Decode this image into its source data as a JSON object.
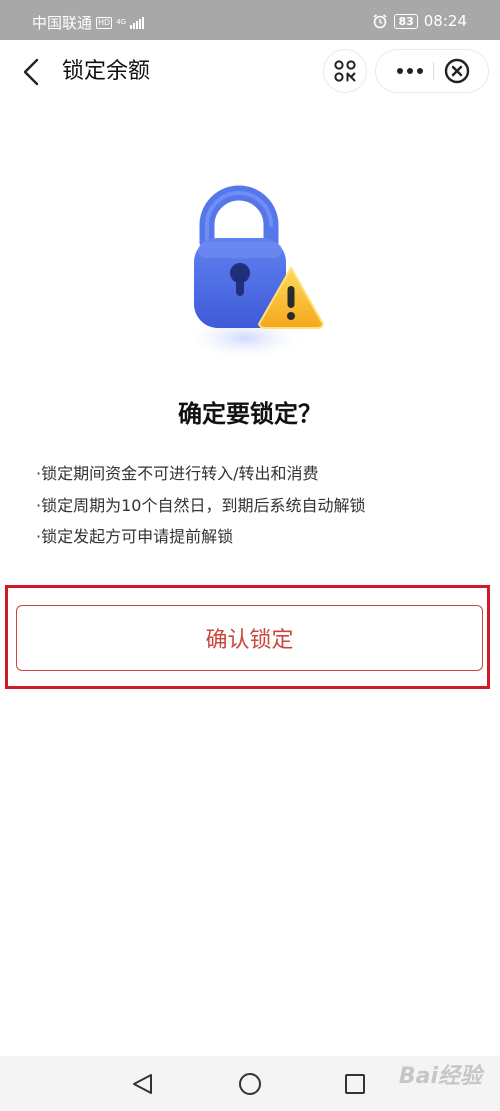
{
  "status_bar": {
    "carrier": "中国联通",
    "hd": "HD",
    "network": "4G",
    "battery": "83",
    "time": "08:24"
  },
  "nav": {
    "title": "锁定余额"
  },
  "dialog": {
    "heading": "确定要锁定？",
    "notes": [
      "·锁定期间资金不可进行转入/转出和消费",
      "·锁定周期为10个自然日，到期后系统自动解锁",
      "·锁定发起方可申请提前解锁"
    ],
    "confirm_label": "确认锁定"
  },
  "watermark": "Bai经验",
  "colors": {
    "status_bar_bg": "#a8a8a8",
    "confirm_text": "#c9483e",
    "highlight_border": "#cf1a2a",
    "lock_body": "#4f6fe6",
    "warning_triangle": "#ffc53a"
  },
  "icons": [
    "back-icon",
    "scan-icon",
    "more-icon",
    "close-circle-icon",
    "alarm-icon",
    "battery-icon",
    "signal-icon",
    "lock-warning-illustration",
    "nav-back-icon",
    "nav-home-icon",
    "nav-recent-icon"
  ]
}
